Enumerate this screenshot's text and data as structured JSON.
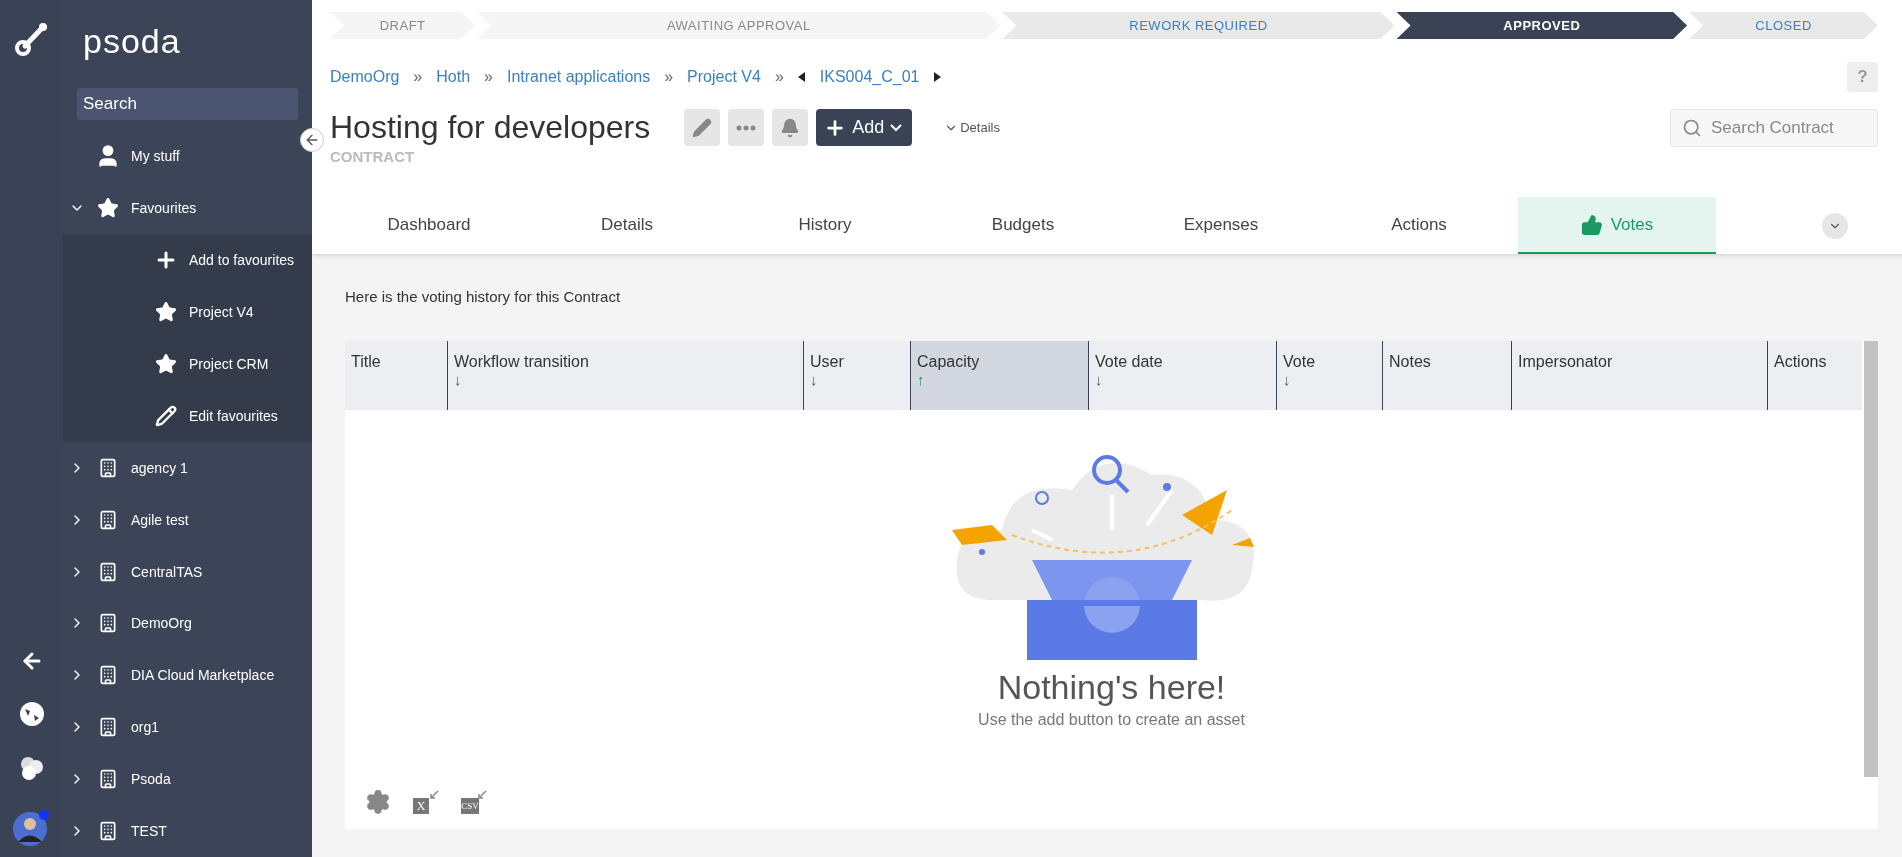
{
  "brand": "psoda",
  "sidebar": {
    "search": {
      "placeholder": "Search"
    },
    "items": [
      {
        "label": "My stuff",
        "kind": "user"
      },
      {
        "label": "Favourites",
        "kind": "star",
        "expanded": true,
        "children": [
          {
            "label": "Add to favourites",
            "kind": "plus"
          },
          {
            "label": "Project V4",
            "kind": "star"
          },
          {
            "label": "Project CRM",
            "kind": "star"
          },
          {
            "label": "Edit favourites",
            "kind": "pencil"
          }
        ]
      },
      {
        "label": "agency 1",
        "kind": "building",
        "expanded": false
      },
      {
        "label": "Agile test",
        "kind": "building",
        "expanded": false
      },
      {
        "label": "CentralTAS",
        "kind": "building",
        "expanded": false
      },
      {
        "label": "DemoOrg",
        "kind": "building",
        "expanded": false
      },
      {
        "label": "DIA Cloud Marketplace",
        "kind": "building",
        "expanded": false
      },
      {
        "label": "org1",
        "kind": "building",
        "expanded": false
      },
      {
        "label": "Psoda",
        "kind": "building",
        "expanded": false
      },
      {
        "label": "TEST",
        "kind": "building",
        "expanded": false
      }
    ]
  },
  "workflow": [
    {
      "label": "DRAFT",
      "kind": "past"
    },
    {
      "label": "AWAITING APPROVAL",
      "kind": "past"
    },
    {
      "label": "REWORK REQUIRED",
      "kind": "next"
    },
    {
      "label": "APPROVED",
      "kind": "current"
    },
    {
      "label": "CLOSED",
      "kind": "next"
    }
  ],
  "breadcrumb": [
    "DemoOrg",
    "Hoth",
    "Intranet applications",
    "Project V4"
  ],
  "breadcrumb_separator": "»",
  "record_nav": {
    "label": "IKS004_C_01"
  },
  "help": "?",
  "title": "Hosting for developers",
  "subtitle": "CONTRACT",
  "add_button": "Add",
  "details_toggle": "Details",
  "search_contract": {
    "placeholder": "Search Contract"
  },
  "tabs": [
    {
      "label": "Dashboard",
      "selected": false
    },
    {
      "label": "Details",
      "selected": false
    },
    {
      "label": "History",
      "selected": false
    },
    {
      "label": "Budgets",
      "selected": false
    },
    {
      "label": "Expenses",
      "selected": false
    },
    {
      "label": "Actions",
      "selected": false
    },
    {
      "label": "Votes",
      "selected": true
    }
  ],
  "intro": "Here is the voting history for this Contract",
  "table": {
    "columns": [
      {
        "label": "Title"
      },
      {
        "label": "Workflow transition",
        "sort": "↓",
        "sorted": false
      },
      {
        "label": "User",
        "sort": "↓",
        "sorted": false
      },
      {
        "label": "Capacity",
        "sort": "↑",
        "sorted": true
      },
      {
        "label": "Vote date",
        "sort": "↓",
        "sorted": false
      },
      {
        "label": "Vote",
        "sort": "↓",
        "sorted": false
      },
      {
        "label": "Notes"
      },
      {
        "label": "Impersonator"
      },
      {
        "label": "Actions"
      }
    ],
    "empty": {
      "title": "Nothing's here!",
      "text": "Use the add button to create an asset"
    },
    "exports": [
      {
        "kind": "excel",
        "glyph": "X"
      },
      {
        "kind": "csv",
        "glyph": "CSV"
      }
    ]
  }
}
